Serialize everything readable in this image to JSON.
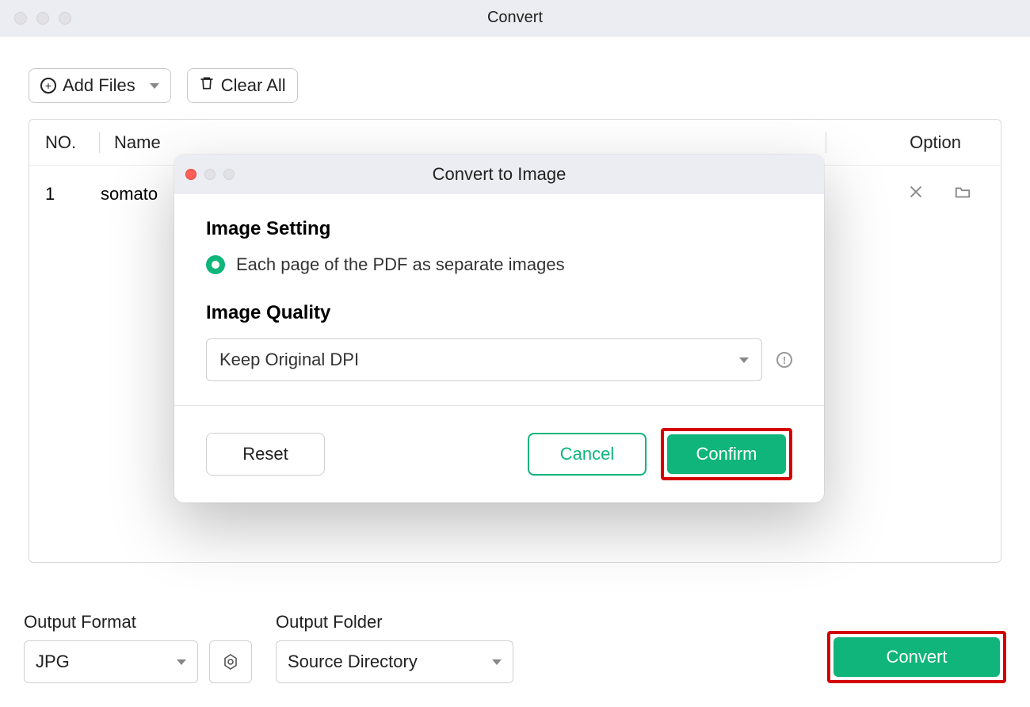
{
  "window": {
    "title": "Convert"
  },
  "toolbar": {
    "add_files_label": "Add Files",
    "clear_all_label": "Clear All"
  },
  "table": {
    "headers": {
      "no": "NO.",
      "name": "Name",
      "option": "Option"
    },
    "rows": [
      {
        "no": "1",
        "name": "somato"
      }
    ]
  },
  "bottom": {
    "output_format_label": "Output Format",
    "output_format_value": "JPG",
    "output_folder_label": "Output Folder",
    "output_folder_value": "Source Directory",
    "convert_button": "Convert"
  },
  "modal": {
    "title": "Convert to Image",
    "image_setting_heading": "Image Setting",
    "radio_option_label": "Each page of the PDF as separate images",
    "image_quality_heading": "Image Quality",
    "quality_value": "Keep Original DPI",
    "reset_button": "Reset",
    "cancel_button": "Cancel",
    "confirm_button": "Confirm"
  },
  "colors": {
    "accent": "#0fb57a",
    "highlight_border": "#d40000"
  }
}
